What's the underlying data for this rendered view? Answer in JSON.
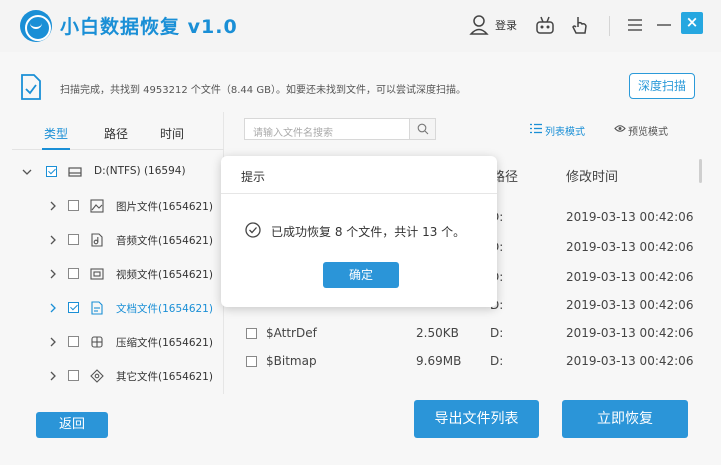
{
  "app": {
    "title": "小白数据恢复 v1.0",
    "login_label": "登录",
    "close_glyph": "×"
  },
  "info": {
    "message": "扫描完成，共找到 4953212 个文件（8.44 GB）。如要还未找到文件，可以尝试深度扫描。",
    "deep_scan_label": "深度扫描"
  },
  "tabs": [
    {
      "label": "类型",
      "active": true
    },
    {
      "label": "路径",
      "active": false
    },
    {
      "label": "时间",
      "active": false
    }
  ],
  "tree": {
    "root": {
      "label": "D:(NTFS) (16594)",
      "checked": true,
      "expanded": true
    },
    "items": [
      {
        "label": "图片文件(1654621)",
        "icon": "image-file-icon",
        "checked": false,
        "highlight": false
      },
      {
        "label": "音频文件(1654621)",
        "icon": "audio-file-icon",
        "checked": false,
        "highlight": false
      },
      {
        "label": "视频文件(1654621)",
        "icon": "video-file-icon",
        "checked": false,
        "highlight": false
      },
      {
        "label": "文档文件(1654621)",
        "icon": "document-file-icon",
        "checked": true,
        "highlight": true
      },
      {
        "label": "压缩文件(1654621)",
        "icon": "archive-file-icon",
        "checked": false,
        "highlight": false
      },
      {
        "label": "其它文件(1654621)",
        "icon": "other-file-icon",
        "checked": false,
        "highlight": false
      }
    ]
  },
  "search": {
    "placeholder": "请输入文件名搜索"
  },
  "view_modes": {
    "list": "列表模式",
    "preview": "预览模式"
  },
  "table": {
    "headers": {
      "path": "路径",
      "time": "修改时间"
    },
    "rows": [
      {
        "name": "",
        "size": "",
        "path": "D:",
        "time": "2019-03-13 00:42:06"
      },
      {
        "name": "",
        "size": "",
        "path": "D:",
        "time": "2019-03-13 00:42:06"
      },
      {
        "name": "",
        "size": "",
        "path": "D:",
        "time": "2019-03-13 00:42:06"
      },
      {
        "name": "",
        "size": "",
        "path": "D:",
        "time": "2019-03-13 00:42:06"
      },
      {
        "name": "$AttrDef",
        "size": "2.50KB",
        "path": "D:",
        "time": "2019-03-13 00:42:06"
      },
      {
        "name": "$Bitmap",
        "size": "9.69MB",
        "path": "D:",
        "time": "2019-03-13 00:42:06"
      }
    ]
  },
  "buttons": {
    "back": "返回",
    "export": "导出文件列表",
    "recover": "立即恢复"
  },
  "modal": {
    "title": "提示",
    "message": "已成功恢复 8 个文件，共计 13 个。",
    "ok": "确定"
  },
  "colors": {
    "accent": "#2b95d8",
    "brand": "#1a8fd6"
  }
}
